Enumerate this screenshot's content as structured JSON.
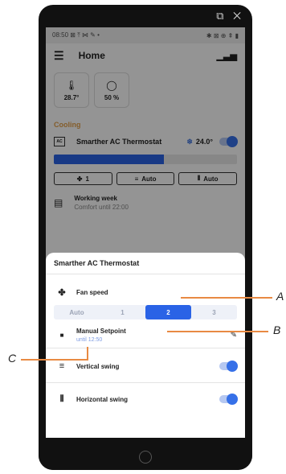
{
  "status_bar": {
    "time": "08:50",
    "left_icons": "⊠ ⤒ ⋈ ✎ •",
    "right_icons": "✱ ⊠ ⊕ ⇞ ▮"
  },
  "window_controls": "⧉ ✕",
  "appbar": {
    "title": "Home"
  },
  "cards": [
    {
      "icon": "thermometer-icon",
      "value": "28.7°"
    },
    {
      "icon": "humidity-icon",
      "value": "50 %"
    }
  ],
  "cooling_label": "Cooling",
  "thermostat": {
    "icon_text": "AC",
    "name": "Smarther AC Thermostat",
    "mode_icon": "snowflake-icon",
    "temperature": "24.0°",
    "progress": 0.6
  },
  "pills": [
    {
      "icon": "fan-icon",
      "label": "1"
    },
    {
      "icon": "vertical-swing-icon",
      "label": "Auto"
    },
    {
      "icon": "horizontal-swing-icon",
      "label": "Auto"
    }
  ],
  "schedule": {
    "title": "Working week",
    "subtitle": "Comfort until 22:00"
  },
  "sheet": {
    "title": "Smarther AC Thermostat",
    "fan_speed_label": "Fan speed",
    "speeds": [
      "Auto",
      "1",
      "2",
      "3"
    ],
    "selected_speed": "2",
    "setpoint": {
      "title": "Manual Setpoint",
      "subtitle": "until 12:50"
    },
    "vertical_swing_label": "Vertical swing",
    "horizontal_swing_label": "Horizontal swing"
  },
  "callouts": {
    "a": "A",
    "b": "B",
    "c": "C"
  },
  "colors": {
    "accent": "#2a63e6",
    "cooling": "#e3a14b",
    "callout": "#e88a43"
  }
}
